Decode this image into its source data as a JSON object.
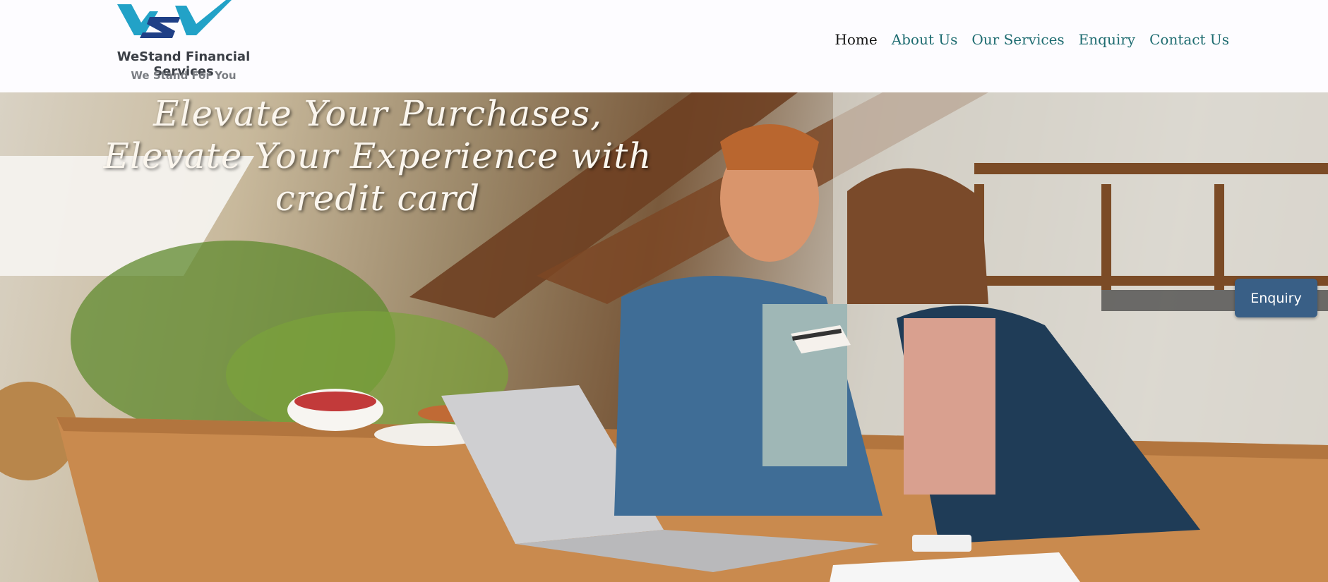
{
  "brand": {
    "name": "WeStand Financial Services",
    "tagline": "We Stand For You",
    "logo_icon": "wsv-logo-mark",
    "colors": {
      "logo_light": "#22a2c7",
      "logo_dark": "#1f3f86"
    }
  },
  "nav": {
    "items": [
      {
        "label": "Home",
        "active": true
      },
      {
        "label": "About Us",
        "active": false
      },
      {
        "label": "Our Services",
        "active": false
      },
      {
        "label": "Enquiry",
        "active": false
      },
      {
        "label": "Contact Us",
        "active": false
      }
    ],
    "colors": {
      "link": "#1d6b70",
      "active": "#111111"
    }
  },
  "hero": {
    "headline_lines": [
      "Elevate Your Purchases,",
      "Elevate Your Experience with",
      "credit card"
    ],
    "floating_button": {
      "label": "Enquiry",
      "color": "#395f86"
    }
  }
}
